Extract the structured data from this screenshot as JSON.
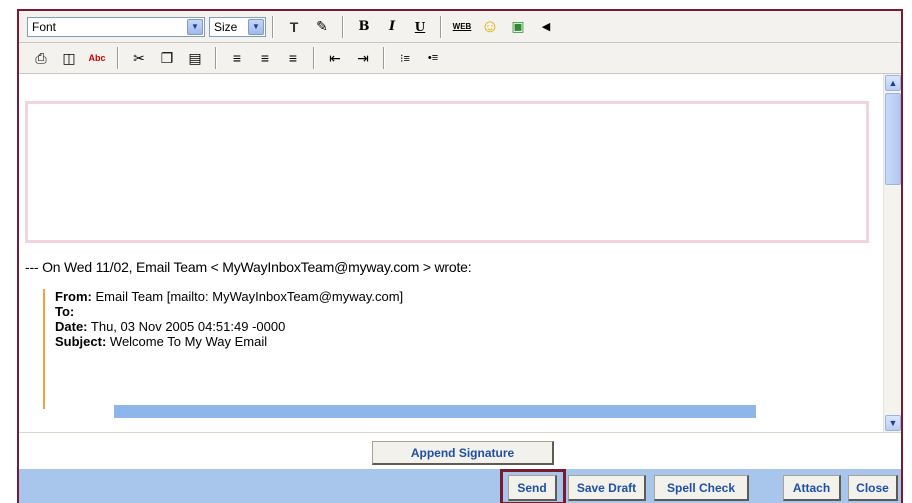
{
  "toolbar1": {
    "font_value": "Font",
    "size_value": "Size",
    "icons": {
      "text_color": "T",
      "highlight": "✎",
      "bold": "B",
      "italic": "I",
      "underline": "U",
      "web_link": "WEB",
      "smiley": "☺",
      "insert_image": "▣",
      "sound": "◀"
    }
  },
  "toolbar2": {
    "icons": {
      "print": "⎙",
      "preview": "◫",
      "spell": "Abc",
      "cut": "✂",
      "copy": "❐",
      "paste": "▤",
      "align_left": "≡",
      "align_center": "≡",
      "align_right": "≡",
      "outdent": "⇤",
      "indent": "⇥",
      "numbered_list": "⁝≡",
      "bullet_list": "•≡"
    }
  },
  "message": {
    "quoted_header": "--- On Wed 11/02, Email Team < MyWayInboxTeam@myway.com > wrote:",
    "from_label": "From:",
    "from_value": " Email Team [mailto: MyWayInboxTeam@myway.com]",
    "to_label": "To:",
    "date_label": "Date:",
    "date_value": " Thu, 03 Nov 2005 04:51:49 -0000",
    "subject_label": "Subject:",
    "subject_value": " Welcome To My Way Email"
  },
  "append_signature": "Append Signature",
  "actions": {
    "send": "Send",
    "save_draft": "Save Draft",
    "spell_check": "Spell Check",
    "attach": "Attach",
    "close": "Close"
  }
}
